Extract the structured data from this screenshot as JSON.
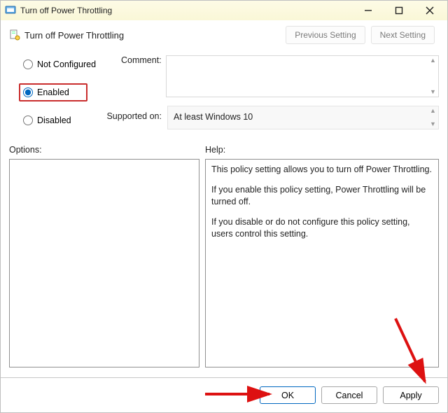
{
  "window": {
    "title": "Turn off Power Throttling"
  },
  "subtitle": "Turn off Power Throttling",
  "nav": {
    "previous": "Previous Setting",
    "next": "Next Setting"
  },
  "radios": {
    "not_configured": "Not Configured",
    "enabled": "Enabled",
    "disabled": "Disabled",
    "selected": "enabled"
  },
  "labels": {
    "comment": "Comment:",
    "supported_on": "Supported on:",
    "options": "Options:",
    "help": "Help:"
  },
  "supported_text": "At least Windows 10",
  "help_text": {
    "p1": "This policy setting allows you to turn off Power Throttling.",
    "p2": "If you enable this policy setting, Power Throttling will be turned off.",
    "p3": "If you disable or do not configure this policy setting, users control this setting."
  },
  "buttons": {
    "ok": "OK",
    "cancel": "Cancel",
    "apply": "Apply"
  }
}
